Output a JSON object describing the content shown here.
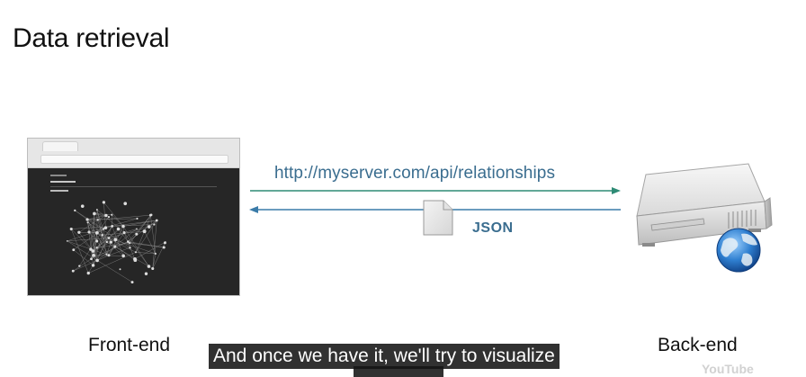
{
  "title": "Data retrieval",
  "request_url": "http://myserver.com/api/relationships",
  "response_format": "JSON",
  "front_end_label": "Front-end",
  "back_end_label": "Back-end",
  "caption": "And once we have it, we'll try to visualize",
  "watermark": "YouTube",
  "colors": {
    "arrow_request": "#2e8b75",
    "arrow_response": "#3a7ba8",
    "label_blue": "#3a6d8f"
  }
}
